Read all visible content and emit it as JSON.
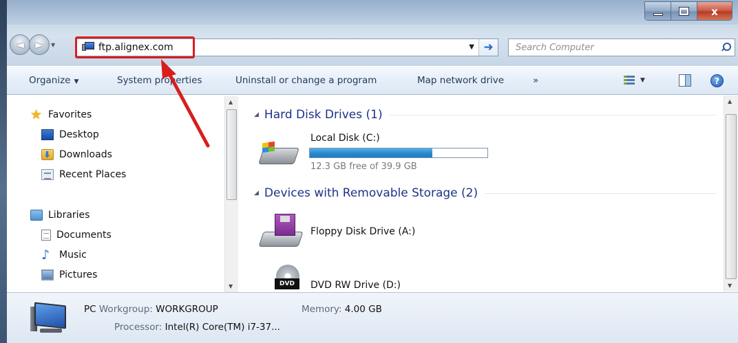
{
  "window": {
    "buttons": {
      "minimize": "",
      "maximize": "",
      "close": "x"
    }
  },
  "nav": {
    "back_label": "◄",
    "forward_label": "►",
    "recent_dropdown": "▼"
  },
  "address": {
    "value": "ftp.alignex.com",
    "dropdown": "▼",
    "go": "➜"
  },
  "search": {
    "placeholder": "Search Computer"
  },
  "toolbar": {
    "organize": "Organize",
    "system_properties": "System properties",
    "uninstall": "Uninstall or change a program",
    "map_network_drive": "Map network drive",
    "more": "»",
    "help": "?"
  },
  "sidebar": {
    "favorites": "Favorites",
    "desktop": "Desktop",
    "downloads": "Downloads",
    "recent_places": "Recent Places",
    "libraries": "Libraries",
    "documents": "Documents",
    "music": "Music",
    "pictures": "Pictures"
  },
  "groups": {
    "hard_disk_drives": "Hard Disk Drives (1)",
    "removable": "Devices with Removable Storage (2)"
  },
  "drives": {
    "local_disk": {
      "name": "Local Disk (C:)",
      "free_text": "12.3 GB free of 39.9 GB",
      "used_fraction": 0.69
    },
    "floppy": {
      "name": "Floppy Disk Drive (A:)"
    },
    "dvd": {
      "name": "DVD RW Drive (D:)",
      "label": "DVD"
    }
  },
  "details": {
    "name": "PC",
    "workgroup_key": "Workgroup:",
    "workgroup_val": "WORKGROUP",
    "memory_key": "Memory:",
    "memory_val": "4.00 GB",
    "processor_key": "Processor:",
    "processor_val": "Intel(R) Core(TM) i7-37..."
  },
  "colors": {
    "annotation": "#d81e1e",
    "disk_fill": "#2a8bcf",
    "group_heading": "#1e3287"
  },
  "icons": [
    "star-icon",
    "desktop-icon",
    "downloads-icon",
    "recent-places-icon",
    "libraries-icon",
    "documents-icon",
    "music-icon",
    "pictures-icon",
    "hdd-icon",
    "floppy-icon",
    "dvd-icon",
    "computer-icon",
    "search-icon",
    "help-icon"
  ]
}
